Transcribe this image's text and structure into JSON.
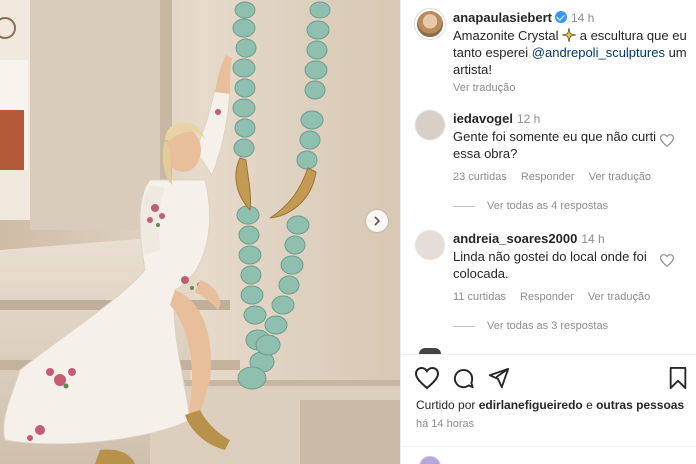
{
  "post": {
    "username": "anapaulasiebert",
    "time": "14 h",
    "caption_pre": "Amazonite Crystal",
    "caption_mid": " a escultura que eu tanto esperei ",
    "mention": "@andrepoli_sculptures",
    "caption_post": " um artista!",
    "translate": "Ver tradução"
  },
  "comments": [
    {
      "username": "iedavogel",
      "time": "12 h",
      "text": "Gente foi somente eu que não curti essa obra?",
      "likes": "23 curtidas",
      "reply": "Responder",
      "translate": "Ver tradução",
      "replies": "Ver todas as 4 respostas"
    },
    {
      "username": "andreia_soares2000",
      "time": "14 h",
      "text": "Linda não gostei do local onde foi colocada.",
      "likes": "11 curtidas",
      "reply": "Responder",
      "translate": "Ver tradução",
      "replies": "Ver todas as 3 respostas"
    }
  ],
  "footer": {
    "liked_prefix": "Curtido por ",
    "liked_user": "edirlanefigueiredo",
    "liked_mid": " e ",
    "liked_others": "outras pessoas",
    "ago": "há 14 horas"
  },
  "icons": [
    "heart-icon",
    "comment-icon",
    "share-icon",
    "bookmark-icon",
    "chevron-right-icon",
    "verified-icon",
    "sparkle-icon"
  ],
  "colors": {
    "verified": "#3897f0",
    "link": "#00376b",
    "muted": "#8e8e8e",
    "text": "#262626"
  }
}
